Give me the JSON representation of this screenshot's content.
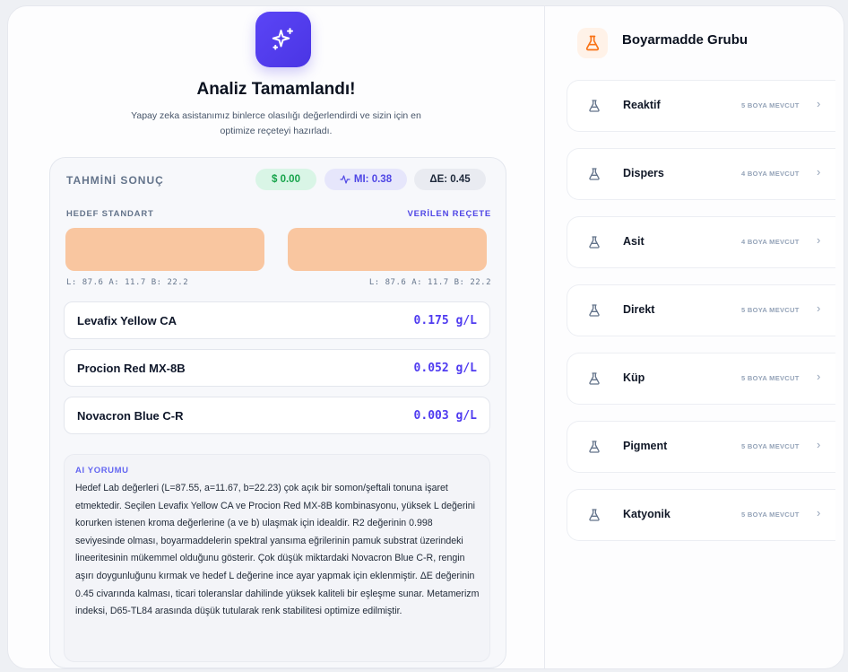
{
  "analysis": {
    "title": "Analiz Tamamlandı!",
    "subtitle": "Yapay zeka asistanımız binlerce olasılığı değerlendirdi ve sizin için en optimize reçeteyi hazırladı."
  },
  "result": {
    "heading": "TAHMİNİ SONUÇ",
    "cost": "$ 0.00",
    "mi": "MI: 0.38",
    "delta_e": "ΔE: 0.45",
    "target_label": "HEDEF STANDART",
    "recipe_label": "VERİLEN REÇETE",
    "target_lab": "L: 87.6  A: 11.7  B: 22.2",
    "recipe_lab": "L: 87.6  A: 11.7  B: 22.2",
    "swatch_color": "#f9c6a0",
    "dyes": [
      {
        "name": "Levafix Yellow CA",
        "amount": "0.175 g/L"
      },
      {
        "name": "Procion Red MX-8B",
        "amount": "0.052 g/L"
      },
      {
        "name": "Novacron Blue C-R",
        "amount": "0.003 g/L"
      }
    ],
    "ai_label": "AI YORUMU",
    "ai_text": "Hedef Lab değerleri (L=87.55, a=11.67, b=22.23) çok açık bir somon/şeftali tonuna işaret etmektedir. Seçilen Levafix Yellow CA ve Procion Red MX-8B kombinasyonu, yüksek L değerini korurken istenen kroma değerlerine (a ve b) ulaşmak için idealdir. R2 değerinin 0.998 seviyesinde olması, boyarmaddelerin spektral yansıma eğrilerinin pamuk substrat üzerindeki lineeritesinin mükemmel olduğunu gösterir. Çok düşük miktardaki Novacron Blue C-R, rengin aşırı doygunluğunu kırmak ve hedef L değerine ince ayar yapmak için eklenmiştir. ΔE değerinin 0.45 civarında kalması, ticari toleranslar dahilinde yüksek kaliteli bir eşleşme sunar. Metamerizm indeksi, D65-TL84 arasında düşük tutularak renk stabilitesi optimize edilmiştir."
  },
  "groups": {
    "title": "Boyarmadde Grubu",
    "items": [
      {
        "name": "Reaktif",
        "count": "5 BOYA MEVCUT"
      },
      {
        "name": "Dispers",
        "count": "4 BOYA MEVCUT"
      },
      {
        "name": "Asit",
        "count": "4 BOYA MEVCUT"
      },
      {
        "name": "Direkt",
        "count": "5 BOYA MEVCUT"
      },
      {
        "name": "Küp",
        "count": "5 BOYA MEVCUT"
      },
      {
        "name": "Pigment",
        "count": "5 BOYA MEVCUT"
      },
      {
        "name": "Katyonik",
        "count": "5 BOYA MEVCUT"
      }
    ]
  },
  "colors": {
    "accent": "#4f46e5",
    "cost_green": "#16a34a",
    "flask_orange": "#f97316"
  },
  "icons": {
    "hero": "sparkles-icon",
    "header": "flask-icon",
    "group": "flask-icon",
    "chevron": "chevron-right-icon",
    "mi": "activity-icon"
  }
}
